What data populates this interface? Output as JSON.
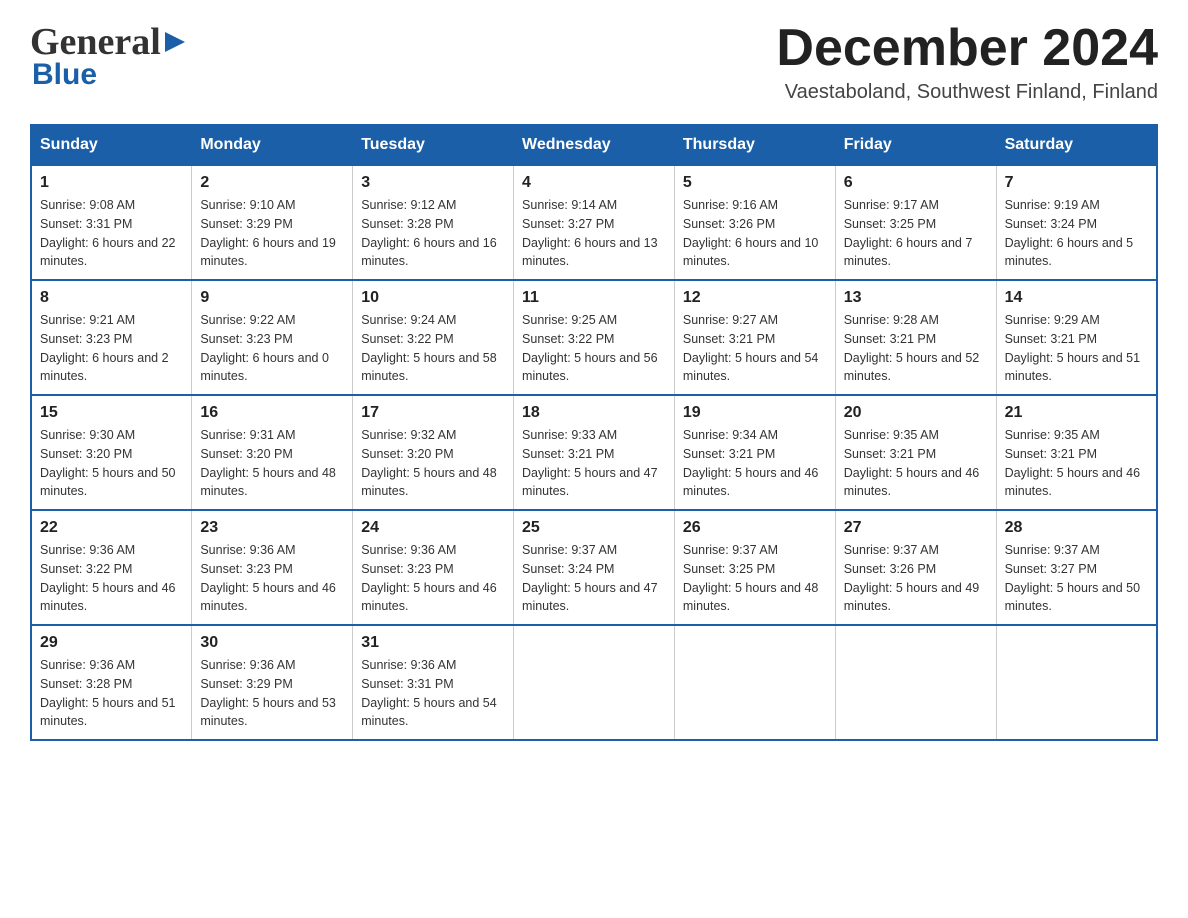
{
  "header": {
    "logo_general": "General",
    "logo_blue": "Blue",
    "month_title": "December 2024",
    "location": "Vaestaboland, Southwest Finland, Finland"
  },
  "weekdays": [
    "Sunday",
    "Monday",
    "Tuesday",
    "Wednesday",
    "Thursday",
    "Friday",
    "Saturday"
  ],
  "weeks": [
    [
      {
        "day": "1",
        "sunrise": "9:08 AM",
        "sunset": "3:31 PM",
        "daylight": "6 hours and 22 minutes."
      },
      {
        "day": "2",
        "sunrise": "9:10 AM",
        "sunset": "3:29 PM",
        "daylight": "6 hours and 19 minutes."
      },
      {
        "day": "3",
        "sunrise": "9:12 AM",
        "sunset": "3:28 PM",
        "daylight": "6 hours and 16 minutes."
      },
      {
        "day": "4",
        "sunrise": "9:14 AM",
        "sunset": "3:27 PM",
        "daylight": "6 hours and 13 minutes."
      },
      {
        "day": "5",
        "sunrise": "9:16 AM",
        "sunset": "3:26 PM",
        "daylight": "6 hours and 10 minutes."
      },
      {
        "day": "6",
        "sunrise": "9:17 AM",
        "sunset": "3:25 PM",
        "daylight": "6 hours and 7 minutes."
      },
      {
        "day": "7",
        "sunrise": "9:19 AM",
        "sunset": "3:24 PM",
        "daylight": "6 hours and 5 minutes."
      }
    ],
    [
      {
        "day": "8",
        "sunrise": "9:21 AM",
        "sunset": "3:23 PM",
        "daylight": "6 hours and 2 minutes."
      },
      {
        "day": "9",
        "sunrise": "9:22 AM",
        "sunset": "3:23 PM",
        "daylight": "6 hours and 0 minutes."
      },
      {
        "day": "10",
        "sunrise": "9:24 AM",
        "sunset": "3:22 PM",
        "daylight": "5 hours and 58 minutes."
      },
      {
        "day": "11",
        "sunrise": "9:25 AM",
        "sunset": "3:22 PM",
        "daylight": "5 hours and 56 minutes."
      },
      {
        "day": "12",
        "sunrise": "9:27 AM",
        "sunset": "3:21 PM",
        "daylight": "5 hours and 54 minutes."
      },
      {
        "day": "13",
        "sunrise": "9:28 AM",
        "sunset": "3:21 PM",
        "daylight": "5 hours and 52 minutes."
      },
      {
        "day": "14",
        "sunrise": "9:29 AM",
        "sunset": "3:21 PM",
        "daylight": "5 hours and 51 minutes."
      }
    ],
    [
      {
        "day": "15",
        "sunrise": "9:30 AM",
        "sunset": "3:20 PM",
        "daylight": "5 hours and 50 minutes."
      },
      {
        "day": "16",
        "sunrise": "9:31 AM",
        "sunset": "3:20 PM",
        "daylight": "5 hours and 48 minutes."
      },
      {
        "day": "17",
        "sunrise": "9:32 AM",
        "sunset": "3:20 PM",
        "daylight": "5 hours and 48 minutes."
      },
      {
        "day": "18",
        "sunrise": "9:33 AM",
        "sunset": "3:21 PM",
        "daylight": "5 hours and 47 minutes."
      },
      {
        "day": "19",
        "sunrise": "9:34 AM",
        "sunset": "3:21 PM",
        "daylight": "5 hours and 46 minutes."
      },
      {
        "day": "20",
        "sunrise": "9:35 AM",
        "sunset": "3:21 PM",
        "daylight": "5 hours and 46 minutes."
      },
      {
        "day": "21",
        "sunrise": "9:35 AM",
        "sunset": "3:21 PM",
        "daylight": "5 hours and 46 minutes."
      }
    ],
    [
      {
        "day": "22",
        "sunrise": "9:36 AM",
        "sunset": "3:22 PM",
        "daylight": "5 hours and 46 minutes."
      },
      {
        "day": "23",
        "sunrise": "9:36 AM",
        "sunset": "3:23 PM",
        "daylight": "5 hours and 46 minutes."
      },
      {
        "day": "24",
        "sunrise": "9:36 AM",
        "sunset": "3:23 PM",
        "daylight": "5 hours and 46 minutes."
      },
      {
        "day": "25",
        "sunrise": "9:37 AM",
        "sunset": "3:24 PM",
        "daylight": "5 hours and 47 minutes."
      },
      {
        "day": "26",
        "sunrise": "9:37 AM",
        "sunset": "3:25 PM",
        "daylight": "5 hours and 48 minutes."
      },
      {
        "day": "27",
        "sunrise": "9:37 AM",
        "sunset": "3:26 PM",
        "daylight": "5 hours and 49 minutes."
      },
      {
        "day": "28",
        "sunrise": "9:37 AM",
        "sunset": "3:27 PM",
        "daylight": "5 hours and 50 minutes."
      }
    ],
    [
      {
        "day": "29",
        "sunrise": "9:36 AM",
        "sunset": "3:28 PM",
        "daylight": "5 hours and 51 minutes."
      },
      {
        "day": "30",
        "sunrise": "9:36 AM",
        "sunset": "3:29 PM",
        "daylight": "5 hours and 53 minutes."
      },
      {
        "day": "31",
        "sunrise": "9:36 AM",
        "sunset": "3:31 PM",
        "daylight": "5 hours and 54 minutes."
      },
      null,
      null,
      null,
      null
    ]
  ]
}
